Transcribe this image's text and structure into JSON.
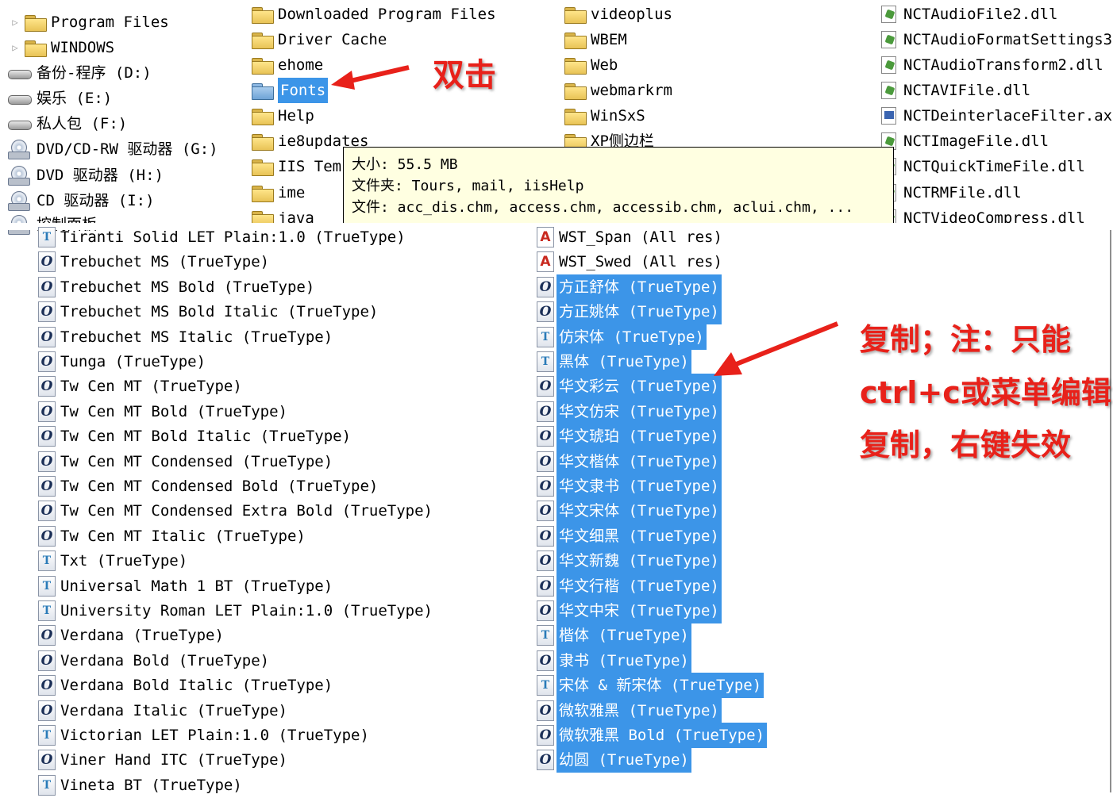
{
  "top_panel": {
    "tree": [
      {
        "label": "Program Files",
        "kind": "folder"
      },
      {
        "label": "WINDOWS",
        "kind": "folder"
      },
      {
        "label": "备份-程序  (D:)",
        "kind": "drive"
      },
      {
        "label": "娱乐  (E:)",
        "kind": "drive"
      },
      {
        "label": "私人包  (F:)",
        "kind": "drive"
      },
      {
        "label": "DVD/CD-RW 驱动器  (G:)",
        "kind": "cd"
      },
      {
        "label": "DVD 驱动器  (H:)",
        "kind": "cd"
      },
      {
        "label": "CD 驱动器  (I:)",
        "kind": "cd"
      },
      {
        "label": "控制面板",
        "kind": "cd"
      }
    ],
    "col1": [
      "Downloaded Program Files",
      "Driver Cache",
      "ehome",
      "Fonts",
      "Help",
      "ie8updates",
      "IIS Tem",
      "ime",
      "java"
    ],
    "col2": [
      "videoplus",
      "WBEM",
      "Web",
      "webmarkrm",
      "WinSxS",
      "XP侧边栏"
    ],
    "col3": [
      "NCTAudioFile2.dll",
      "NCTAudioFormatSettings3",
      "NCTAudioTransform2.dll",
      "NCTAVIFile.dll",
      "NCTDeinterlaceFilter.ax",
      "NCTImageFile.dll",
      "NCTQuickTimeFile.dll",
      "NCTRMFile.dll",
      "NCTVideoCompress.dll"
    ],
    "tooltip": {
      "size": "大小: 55.5 MB",
      "folders": "文件夹: Tours, mail, iisHelp",
      "files": "文件: acc_dis.chm, access.chm, accessib.chm, aclui.chm, ..."
    },
    "annotation": "双击"
  },
  "bottom_panel": {
    "left_fonts": [
      {
        "label": "Tiranti Solid LET Plain:1.0 (TrueType)",
        "icon": "ft"
      },
      {
        "label": "Trebuchet MS (TrueType)",
        "icon": "fo"
      },
      {
        "label": "Trebuchet MS Bold (TrueType)",
        "icon": "fo"
      },
      {
        "label": "Trebuchet MS Bold Italic (TrueType)",
        "icon": "fo"
      },
      {
        "label": "Trebuchet MS Italic (TrueType)",
        "icon": "fo"
      },
      {
        "label": "Tunga (TrueType)",
        "icon": "fo"
      },
      {
        "label": "Tw Cen MT (TrueType)",
        "icon": "fo"
      },
      {
        "label": "Tw Cen MT Bold (TrueType)",
        "icon": "fo"
      },
      {
        "label": "Tw Cen MT Bold Italic (TrueType)",
        "icon": "fo"
      },
      {
        "label": "Tw Cen MT Condensed (TrueType)",
        "icon": "fo"
      },
      {
        "label": "Tw Cen MT Condensed Bold (TrueType)",
        "icon": "fo"
      },
      {
        "label": "Tw Cen MT Condensed Extra Bold (TrueType)",
        "icon": "fo"
      },
      {
        "label": "Tw Cen MT Italic (TrueType)",
        "icon": "fo"
      },
      {
        "label": "Txt (TrueType)",
        "icon": "ft"
      },
      {
        "label": "Universal Math 1 BT (TrueType)",
        "icon": "ft"
      },
      {
        "label": "University Roman LET Plain:1.0 (TrueType)",
        "icon": "ft"
      },
      {
        "label": "Verdana (TrueType)",
        "icon": "fo"
      },
      {
        "label": "Verdana Bold (TrueType)",
        "icon": "fo"
      },
      {
        "label": "Verdana Bold Italic (TrueType)",
        "icon": "fo"
      },
      {
        "label": "Verdana Italic (TrueType)",
        "icon": "fo"
      },
      {
        "label": "Victorian LET Plain:1.0 (TrueType)",
        "icon": "ft"
      },
      {
        "label": "Viner Hand ITC (TrueType)",
        "icon": "fo"
      },
      {
        "label": "Vineta BT (TrueType)",
        "icon": "ft"
      }
    ],
    "right_fonts": [
      {
        "label": "WST_Span (All res)",
        "icon": "fa",
        "selected": false
      },
      {
        "label": "WST_Swed (All res)",
        "icon": "fa",
        "selected": false
      },
      {
        "label": "方正舒体 (TrueType)",
        "icon": "fo",
        "selected": true
      },
      {
        "label": "方正姚体 (TrueType)",
        "icon": "fo",
        "selected": true
      },
      {
        "label": "仿宋体 (TrueType)",
        "icon": "ft",
        "selected": true
      },
      {
        "label": "黑体 (TrueType)",
        "icon": "ft",
        "selected": true
      },
      {
        "label": "华文彩云 (TrueType)",
        "icon": "fo",
        "selected": true
      },
      {
        "label": "华文仿宋 (TrueType)",
        "icon": "fo",
        "selected": true
      },
      {
        "label": "华文琥珀 (TrueType)",
        "icon": "fo",
        "selected": true
      },
      {
        "label": "华文楷体 (TrueType)",
        "icon": "fo",
        "selected": true
      },
      {
        "label": "华文隶书 (TrueType)",
        "icon": "fo",
        "selected": true
      },
      {
        "label": "华文宋体 (TrueType)",
        "icon": "fo",
        "selected": true
      },
      {
        "label": "华文细黑 (TrueType)",
        "icon": "fo",
        "selected": true
      },
      {
        "label": "华文新魏 (TrueType)",
        "icon": "fo",
        "selected": true
      },
      {
        "label": "华文行楷 (TrueType)",
        "icon": "fo",
        "selected": true
      },
      {
        "label": "华文中宋 (TrueType)",
        "icon": "fo",
        "selected": true
      },
      {
        "label": "楷体 (TrueType)",
        "icon": "ft",
        "selected": true
      },
      {
        "label": "隶书 (TrueType)",
        "icon": "fo",
        "selected": true
      },
      {
        "label": "宋体 & 新宋体 (TrueType)",
        "icon": "ft",
        "selected": true
      },
      {
        "label": "微软雅黑 (TrueType)",
        "icon": "fo",
        "selected": true
      },
      {
        "label": "微软雅黑 Bold (TrueType)",
        "icon": "fo",
        "selected": true
      },
      {
        "label": "幼圆 (TrueType)",
        "icon": "fo",
        "selected": true
      }
    ],
    "annotation_lines": [
      "复制；注：只能",
      "ctrl+c或菜单编辑",
      "复制，右键失效"
    ]
  },
  "colors": {
    "selection": "#3c95e8",
    "annotation": "#e8211a",
    "tooltip_bg": "#ffffe1"
  }
}
